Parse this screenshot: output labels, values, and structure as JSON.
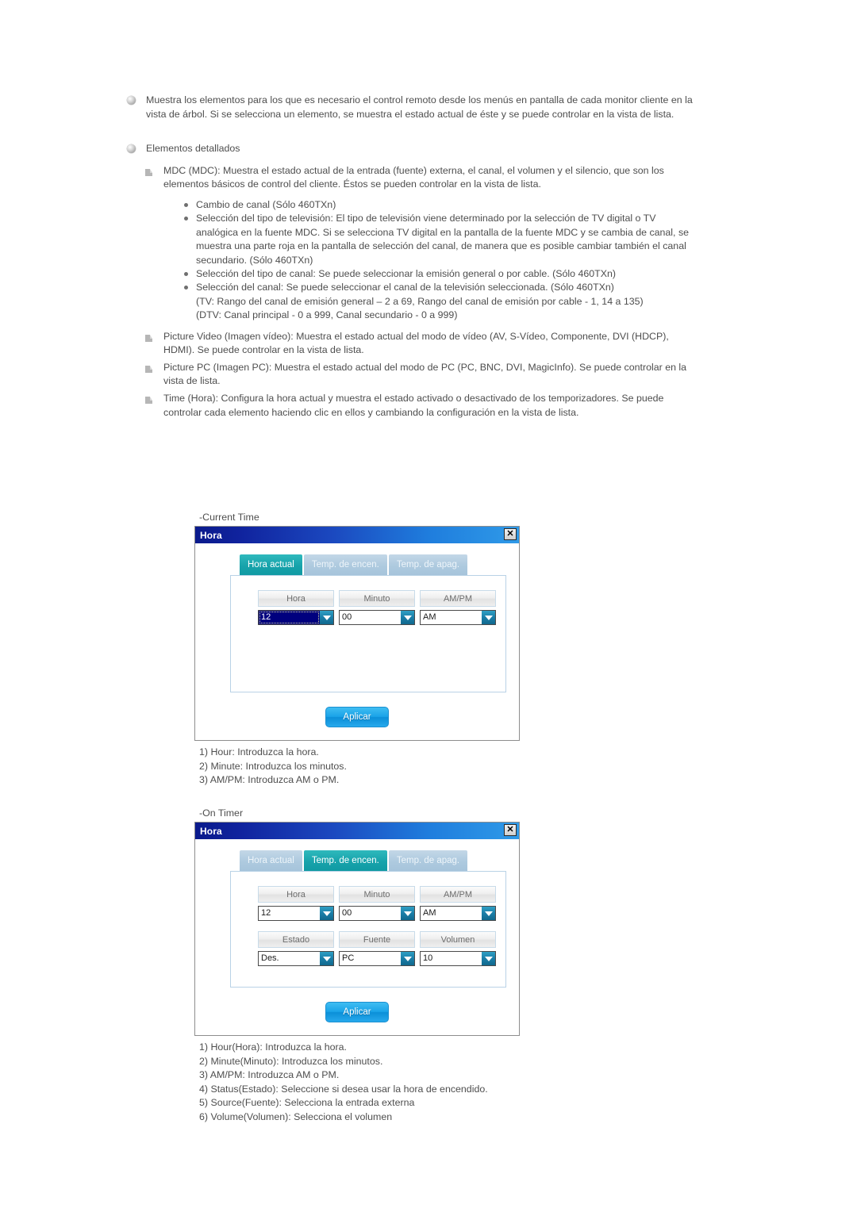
{
  "body": {
    "intro_paragraph": "Muestra los elementos para los que es necesario el control remoto desde los menús en pantalla de cada monitor cliente en la vista de árbol. Si se selecciona un elemento, se muestra el estado actual de éste y se puede controlar en la vista de lista.",
    "detailed_items_heading": "Elementos detallados",
    "mdc_item": "MDC (MDC): Muestra el estado actual de la entrada (fuente) externa, el canal, el volumen y el silencio, que son los elementos básicos de control del cliente. Éstos se pueden controlar en la vista de lista.",
    "mdc_bullets": [
      "Cambio de canal (Sólo 460TXn)",
      "Selección del tipo de televisión: El tipo de televisión viene determinado por la selección de TV digital o TV analógica en la fuente MDC. Si se selecciona TV digital en la pantalla de la fuente MDC y se cambia de canal, se muestra una parte roja en la pantalla de selección del canal, de manera que es posible cambiar también el canal secundario. (Sólo 460TXn)",
      "Selección del tipo de canal: Se puede seleccionar la emisión general o por cable. (Sólo 460TXn)",
      "Selección del canal: Se puede seleccionar el canal de la televisión seleccionada. (Sólo 460TXn)"
    ],
    "channel_range_line_1": "(TV: Rango del canal de emisión general – 2 a 69, Rango del canal de emisión por cable - 1, 14 a 135)",
    "channel_range_line_2": "(DTV: Canal principal - 0 a 999, Canal secundario - 0 a 999)",
    "picture_video_item": "Picture Video (Imagen vídeo): Muestra el estado actual del modo de vídeo (AV, S-Vídeo, Componente, DVI (HDCP), HDMI). Se puede controlar en la vista de lista.",
    "picture_pc_item": "Picture PC (Imagen PC): Muestra el estado actual del modo de PC (PC, BNC, DVI, MagicInfo). Se puede controlar en la vista de lista.",
    "time_item": "Time (Hora): Configura la hora actual y muestra el estado activado o desactivado de los temporizadores. Se puede controlar cada elemento haciendo clic en ellos y cambiando la configuración en la vista de lista."
  },
  "current_time_section": {
    "caption": "-Current Time",
    "dialog": {
      "title": "Hora",
      "close_label": "✕",
      "tabs": [
        {
          "label": "Hora actual",
          "state": "active"
        },
        {
          "label": "Temp. de encen.",
          "state": "inactive"
        },
        {
          "label": "Temp. de apag.",
          "state": "inactive"
        }
      ],
      "fields": [
        {
          "label": "Hora",
          "value": "12",
          "focused": true
        },
        {
          "label": "Minuto",
          "value": "00",
          "focused": false
        },
        {
          "label": "AM/PM",
          "value": "AM",
          "focused": false
        }
      ],
      "apply_label": "Aplicar"
    },
    "legend": [
      "1) Hour: Introduzca la hora.",
      "2) Minute: Introduzca los minutos.",
      "3) AM/PM: Introduzca AM o PM."
    ]
  },
  "on_timer_section": {
    "caption": "-On Timer",
    "dialog": {
      "title": "Hora",
      "close_label": "✕",
      "tabs": [
        {
          "label": "Hora actual",
          "state": "inactive"
        },
        {
          "label": "Temp. de encen.",
          "state": "active"
        },
        {
          "label": "Temp. de apag.",
          "state": "inactive"
        }
      ],
      "row1": [
        {
          "label": "Hora",
          "value": "12"
        },
        {
          "label": "Minuto",
          "value": "00"
        },
        {
          "label": "AM/PM",
          "value": "AM"
        }
      ],
      "row2": [
        {
          "label": "Estado",
          "value": "Des."
        },
        {
          "label": "Fuente",
          "value": "PC"
        },
        {
          "label": "Volumen",
          "value": "10"
        }
      ],
      "apply_label": "Aplicar"
    },
    "legend": [
      "1) Hour(Hora): Introduzca la hora.",
      "2) Minute(Minuto): Introduzca los minutos.",
      "3) AM/PM: Introduzca AM o PM.",
      "4) Status(Estado): Seleccione si desea usar la hora de encendido.",
      "5) Source(Fuente): Selecciona la entrada externa",
      "6) Volume(Volumen): Selecciona el volumen"
    ]
  },
  "colors": {
    "titlebar_start": "#0a1a8c",
    "titlebar_end": "#2f9ae8",
    "tab_active": "#17a3ab",
    "tab_inactive": "#aecadf",
    "apply_button": "#1aa3e8",
    "focus_highlight": "#00007e",
    "text": "#4e4e4e"
  }
}
